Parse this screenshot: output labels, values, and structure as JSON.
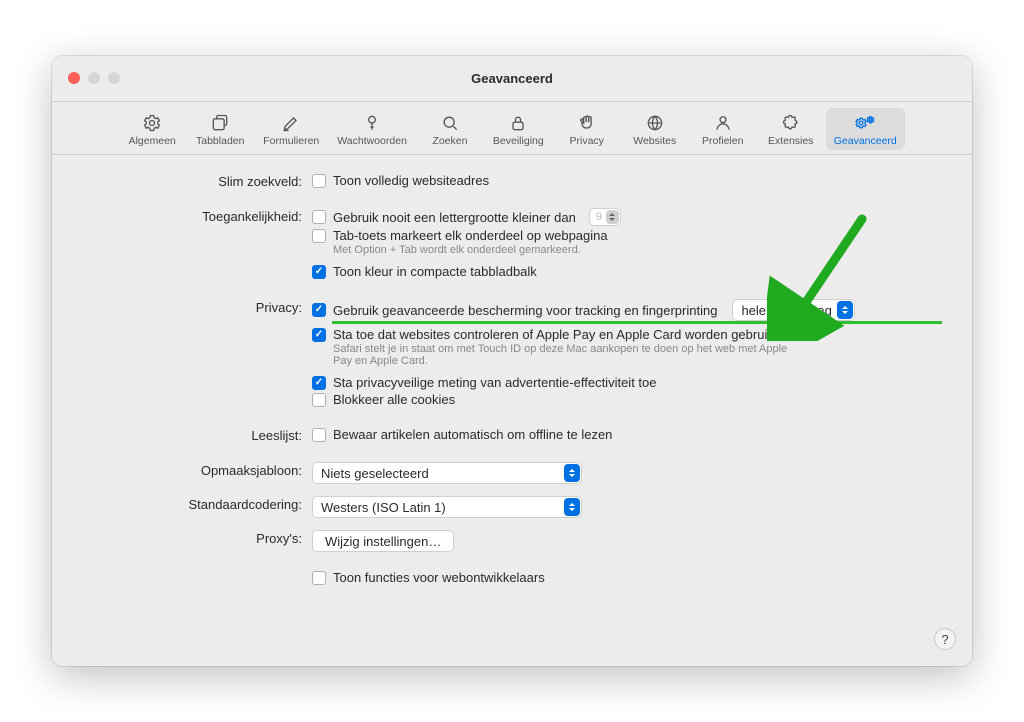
{
  "window": {
    "title": "Geavanceerd"
  },
  "toolbar": [
    {
      "key": "general",
      "label": "Algemeen"
    },
    {
      "key": "tabs",
      "label": "Tabbladen"
    },
    {
      "key": "forms",
      "label": "Formulieren"
    },
    {
      "key": "pw",
      "label": "Wachtwoorden"
    },
    {
      "key": "search",
      "label": "Zoeken"
    },
    {
      "key": "security",
      "label": "Beveiliging"
    },
    {
      "key": "privacy",
      "label": "Privacy"
    },
    {
      "key": "websites",
      "label": "Websites"
    },
    {
      "key": "profiles",
      "label": "Profielen"
    },
    {
      "key": "ext",
      "label": "Extensies"
    },
    {
      "key": "advanced",
      "label": "Geavanceerd"
    }
  ],
  "sections": {
    "smartSearch": {
      "label": "Slim zoekveld:",
      "showFullAddress": "Toon volledig websiteadres"
    },
    "accessibility": {
      "label": "Toegankelijkheid:",
      "neverSmaller": "Gebruik nooit een lettergrootte kleiner dan",
      "fontSize": "9",
      "tabHighlights": "Tab-toets markeert elk onderdeel op webpagina",
      "tabHelp": "Met Option + Tab wordt elk onderdeel gemarkeerd.",
      "showColor": "Toon kleur in compacte tabbladbalk"
    },
    "privacy": {
      "label": "Privacy:",
      "advancedTracking": "Gebruik geavanceerde bescherming voor tracking en fingerprinting",
      "trackingScope": "hele surfgedrag",
      "allowApplePay": "Sta toe dat websites controleren of Apple Pay en Apple Card worden gebruikt",
      "applePayHelp": "Safari stelt je in staat om met Touch ID op deze Mac aankopen te doen op het web met Apple Pay en Apple Card.",
      "allowAdMeasure": "Sta privacyveilige meting van advertentie-effectiviteit toe",
      "blockCookies": "Blokkeer alle cookies"
    },
    "readingList": {
      "label": "Leeslijst:",
      "saveOffline": "Bewaar artikelen automatisch om offline te lezen"
    },
    "stylesheet": {
      "label": "Opmaaksjabloon:",
      "value": "Niets geselecteerd"
    },
    "encoding": {
      "label": "Standaardcodering:",
      "value": "Westers (ISO Latin 1)"
    },
    "proxies": {
      "label": "Proxy's:",
      "button": "Wijzig instellingen…"
    },
    "devMenu": "Toon functies voor webontwikkelaars"
  },
  "help": "?"
}
